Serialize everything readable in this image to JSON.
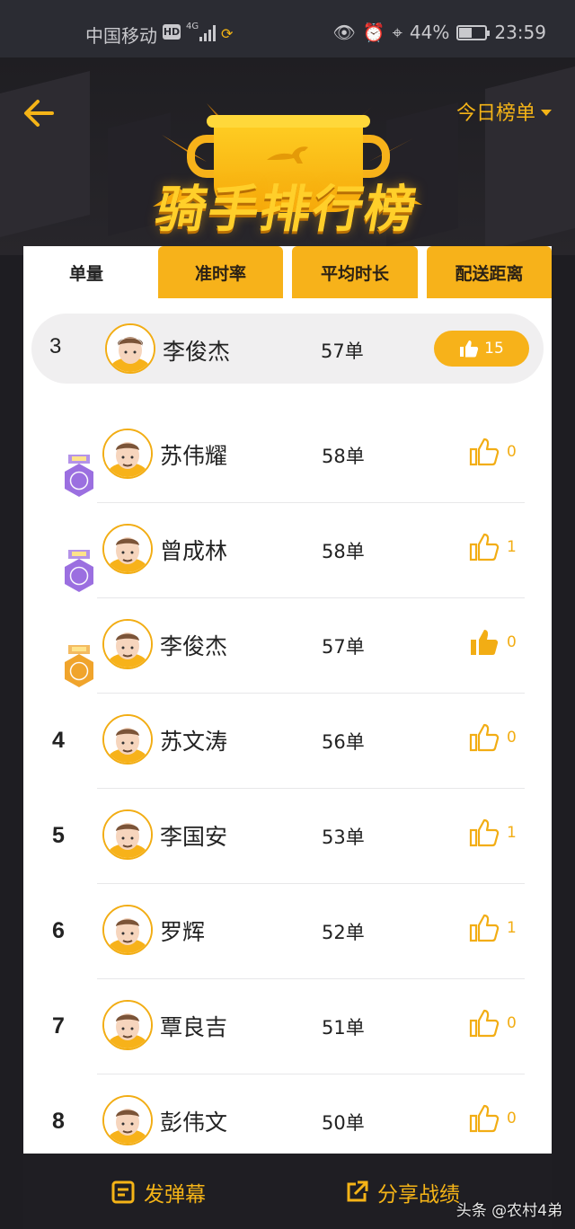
{
  "status_bar": {
    "carrier": "中国移动",
    "hd": "HD",
    "network": "4G",
    "battery": "44%",
    "time": "23:59",
    "battery_level": 0.44
  },
  "header": {
    "title": "骑手排行榜",
    "range_label": "今日榜单",
    "icons": {
      "back": "back-arrow-icon",
      "range": "caret-down-icon"
    }
  },
  "tabs": [
    {
      "label": "单量",
      "active": true
    },
    {
      "label": "准时率",
      "active": false
    },
    {
      "label": "平均时长",
      "active": false
    },
    {
      "label": "配送距离",
      "active": false
    }
  ],
  "my_rank": {
    "rank": "3",
    "name": "李俊杰",
    "count": "57单",
    "likes": "15"
  },
  "rows": [
    {
      "medal": "1",
      "medal_color": "#9b6fe0",
      "name": "苏伟耀",
      "count": "58单",
      "likes": "0",
      "liked": false
    },
    {
      "medal": "1",
      "medal_color": "#9b6fe0",
      "name": "曾成林",
      "count": "58单",
      "likes": "1",
      "liked": false
    },
    {
      "medal": "3",
      "medal_color": "#f0a42c",
      "name": "李俊杰",
      "count": "57单",
      "likes": "0",
      "liked": true
    },
    {
      "rank": "4",
      "name": "苏文涛",
      "count": "56单",
      "likes": "0",
      "liked": false
    },
    {
      "rank": "5",
      "name": "李国安",
      "count": "53单",
      "likes": "1",
      "liked": false
    },
    {
      "rank": "6",
      "name": "罗辉",
      "count": "52单",
      "likes": "1",
      "liked": false
    },
    {
      "rank": "7",
      "name": "覃良吉",
      "count": "51单",
      "likes": "0",
      "liked": false
    },
    {
      "rank": "8",
      "name": "彭伟文",
      "count": "50单",
      "likes": "0",
      "liked": false
    }
  ],
  "footer": {
    "danmaku_label": "发弹幕",
    "share_label": "分享战绩"
  },
  "watermark": "头条 @农村4弟",
  "colors": {
    "accent": "#f7b21a",
    "background": "#1e1d22",
    "card": "#ffffff"
  }
}
